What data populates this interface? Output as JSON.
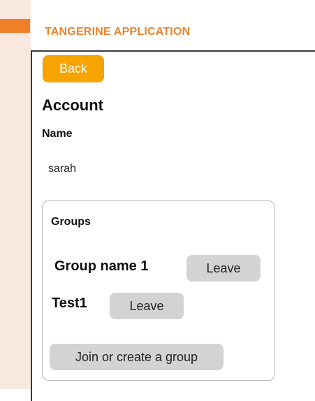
{
  "app": {
    "title": "TANGERINE APPLICATION",
    "accent_color": "#f07f2a",
    "title_color": "#e8822f"
  },
  "toolbar": {
    "back_label": "Back",
    "back_color": "#f7a300"
  },
  "account": {
    "heading": "Account",
    "name_label": "Name",
    "name_value": "sarah"
  },
  "groups": {
    "heading": "Groups",
    "items": [
      {
        "name": "Group name 1",
        "leave_label": "Leave"
      },
      {
        "name": "Test1",
        "leave_label": "Leave"
      }
    ],
    "join_label": "Join or create a group"
  }
}
